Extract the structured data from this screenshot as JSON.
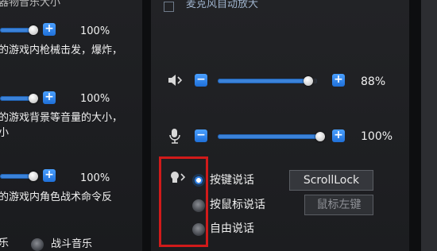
{
  "left": {
    "top_label": "器物音乐大小",
    "rows": [
      {
        "percent": "100%",
        "level": 0.9,
        "desc1": "的游戏内枪械击发，爆炸，",
        "desc2": ""
      },
      {
        "percent": "100%",
        "level": 0.9,
        "desc1": "的游戏背景等音量的大小，",
        "desc2": "小"
      },
      {
        "percent": "100%",
        "level": 0.9,
        "desc1": "的游戏内角色战术命令反",
        "desc2": ""
      }
    ],
    "bottom": {
      "left_text": "乐",
      "option": "战斗音乐"
    }
  },
  "right": {
    "checkbox_label": "麦克风自动放大",
    "speaker": {
      "percent": "88%",
      "level": 0.88
    },
    "mic": {
      "percent": "100%",
      "level": 1.0
    },
    "voice_modes": [
      {
        "label": "按键说话",
        "selected": true,
        "key": "ScrollLock"
      },
      {
        "label": "按鼠标说话",
        "selected": false,
        "key": "鼠标左键"
      },
      {
        "label": "自由说话",
        "selected": false,
        "key": ""
      }
    ]
  },
  "colors": {
    "accent": "#2f7fe3",
    "highlight": "#d11a1a"
  }
}
